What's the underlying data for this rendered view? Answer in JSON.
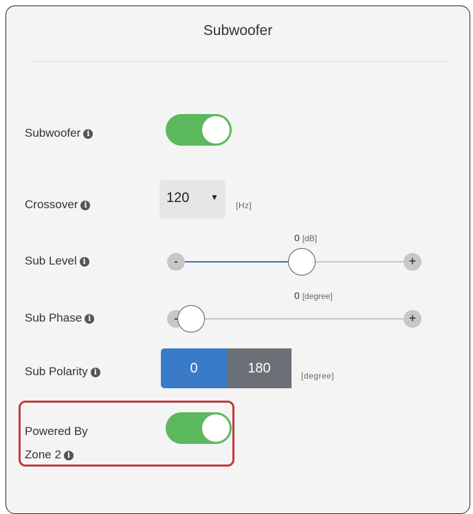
{
  "panel": {
    "title": "Subwoofer"
  },
  "subwoofer": {
    "label": "Subwoofer",
    "enabled": true
  },
  "crossover": {
    "label": "Crossover",
    "value": "120",
    "unit": "[Hz]"
  },
  "sub_level": {
    "label": "Sub Level",
    "value": "0",
    "unit": "[dB]",
    "minus": "-",
    "plus": "+",
    "position_fraction": 0.53
  },
  "sub_phase": {
    "label": "Sub Phase",
    "value": "0",
    "unit": "[degree]",
    "minus": "-",
    "plus": "+",
    "position_fraction": 0.0
  },
  "sub_polarity": {
    "label": "Sub Polarity",
    "options": [
      "0",
      "180"
    ],
    "selected": "0",
    "unit": "[degree]"
  },
  "powered_by_zone2": {
    "label_line1": "Powered By",
    "label_line2": "Zone 2",
    "enabled": true
  },
  "info_glyph": "i",
  "colors": {
    "toggle_on": "#5cb85c",
    "selected_segment": "#3a7bc8",
    "unselected_segment": "#6b7077",
    "highlight": "#c0393b",
    "slider_fill": "#2f6fbf"
  }
}
